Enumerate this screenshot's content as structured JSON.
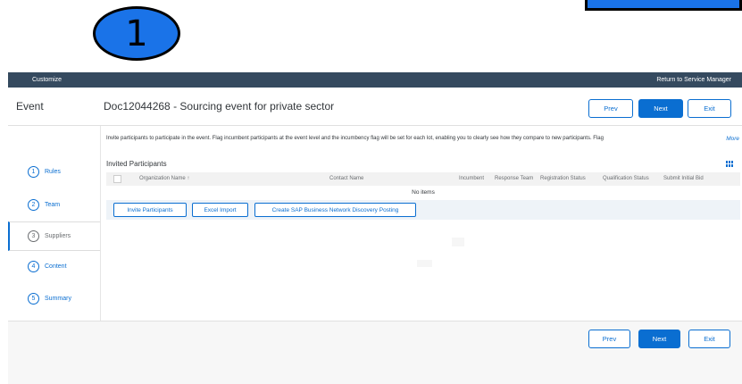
{
  "callout": {
    "number": "1"
  },
  "topbar": {
    "customize": "Customize",
    "return": "Return to Service Manager"
  },
  "header": {
    "label": "Event",
    "title": "Doc12044268 - Sourcing event for private sector",
    "prev": "Prev",
    "next": "Next",
    "exit": "Exit"
  },
  "steps": [
    {
      "num": "1",
      "label": "Rules"
    },
    {
      "num": "2",
      "label": "Team"
    },
    {
      "num": "3",
      "label": "Suppliers"
    },
    {
      "num": "4",
      "label": "Content"
    },
    {
      "num": "5",
      "label": "Summary"
    }
  ],
  "main": {
    "info": "Invite participants to participate in the event. Flag incumbent participants at the event level and the incumbency flag will be set for each lot, enabling you to clearly see how they compare to new participants. Flag",
    "more": "More",
    "section_title": "Invited Participants",
    "columns": {
      "org": "Organization Name ↑",
      "contact": "Contact Name",
      "incumbent": "Incumbent",
      "response": "Response Team",
      "registration": "Registration Status",
      "qualification": "Qualification Status",
      "bid": "Submit Initial Bid"
    },
    "empty": "No items",
    "actions": {
      "invite": "Invite Participants",
      "excel": "Excel Import",
      "posting": "Create SAP Business Network Discovery Posting"
    }
  },
  "footer": {
    "prev": "Prev",
    "next": "Next",
    "exit": "Exit"
  },
  "colors": {
    "primary": "#0a6ed1",
    "shell_bar": "#354a5f",
    "callout": "#1a73e8"
  },
  "icons": {
    "table_settings": "table-settings-icon"
  }
}
